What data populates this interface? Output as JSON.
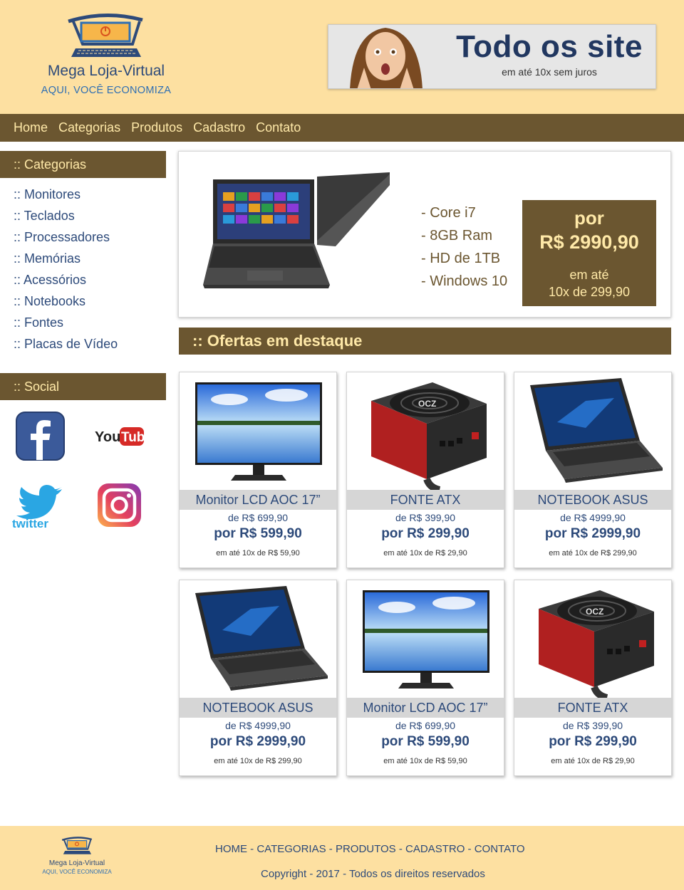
{
  "brand": {
    "name": "Mega Loja-Virtual",
    "slogan": "AQUI, VOCÊ ECONOMIZA"
  },
  "banner": {
    "title": "Todo os site",
    "subtitle": "em até 10x sem juros"
  },
  "nav": [
    "Home",
    "Categorias",
    "Produtos",
    "Cadastro",
    "Contato"
  ],
  "sidebar": {
    "categories_title": ":: Categorias",
    "categories": [
      ":: Monitores",
      ":: Teclados",
      ":: Processadores",
      ":: Memórias",
      ":: Acessórios",
      ":: Notebooks",
      ":: Fontes",
      ":: Placas de Vídeo"
    ],
    "social_title": ":: Social",
    "social": [
      "facebook",
      "youtube",
      "twitter",
      "instagram"
    ]
  },
  "hero": {
    "specs": [
      "- Core i7",
      "- 8GB Ram",
      "- HD de 1TB",
      "- Windows 10"
    ],
    "price_label": "por",
    "price": "R$ 2990,90",
    "installments_line1": "em até",
    "installments_line2": "10x de 299,90"
  },
  "offers": {
    "title": ":: Ofertas em destaque",
    "products": [
      {
        "name": "Monitor LCD AOC 17”",
        "old_price": "de R$ 699,90",
        "new_price": "por R$ 599,90",
        "installments": "em até 10x de R$ 59,90",
        "image": "monitor"
      },
      {
        "name": "FONTE ATX",
        "old_price": "de R$ 399,90",
        "new_price": "por R$ 299,90",
        "installments": "em até 10x de R$ 29,90",
        "image": "psu"
      },
      {
        "name": "NOTEBOOK ASUS",
        "old_price": "de R$ 4999,90",
        "new_price": "por R$ 2999,90",
        "installments": "em até 10x de R$ 299,90",
        "image": "laptop"
      },
      {
        "name": "NOTEBOOK ASUS",
        "old_price": "de R$ 4999,90",
        "new_price": "por R$ 2999,90",
        "installments": "em até 10x de R$ 299,90",
        "image": "laptop"
      },
      {
        "name": "Monitor LCD AOC 17”",
        "old_price": "de R$ 699,90",
        "new_price": "por R$ 599,90",
        "installments": "em até 10x de R$ 59,90",
        "image": "monitor"
      },
      {
        "name": "FONTE ATX",
        "old_price": "de R$ 399,90",
        "new_price": "por R$ 299,90",
        "installments": "em até 10x de R$ 29,90",
        "image": "psu"
      }
    ]
  },
  "footer": {
    "links": [
      "HOME",
      "CATEGORIAS",
      "PRODUTOS",
      "CADASTRO",
      "CONTATO"
    ],
    "separator": " - ",
    "copyright": "Copyright - 2017 - Todos os direitos reservados"
  },
  "colors": {
    "header_bg": "#fde0a1",
    "bar_bg": "#6b5630",
    "bar_text": "#ffe9a8",
    "link_blue": "#2d4a7a"
  }
}
